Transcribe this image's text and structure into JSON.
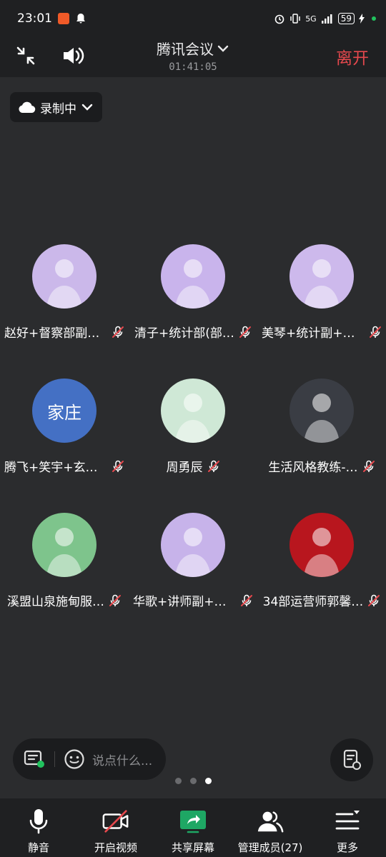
{
  "status": {
    "time": "23:01",
    "network": "5G",
    "battery": "59"
  },
  "header": {
    "title": "腾讯会议",
    "timer": "01:41:05",
    "leave_label": "离开"
  },
  "recording": {
    "label": "录制中"
  },
  "participants": [
    {
      "name": "赵好+督察部副+…",
      "avatar_text": "",
      "avatar_color": "#cbb8ea",
      "muted": true
    },
    {
      "name": "清子+统计部(部…",
      "avatar_text": "",
      "avatar_color": "#c9b4ec",
      "muted": true
    },
    {
      "name": "美琴+统计副+玄…",
      "avatar_text": "",
      "avatar_color": "#cdb9ec",
      "muted": true
    },
    {
      "name": "腾飞+笑宇+玄心…",
      "avatar_text": "家庄",
      "avatar_color": "#4470c4",
      "muted": true
    },
    {
      "name": "周勇辰",
      "avatar_text": "",
      "avatar_color": "#cfe8d6",
      "muted": true
    },
    {
      "name": "生活风格教练-…",
      "avatar_text": "",
      "avatar_color": "#3a3d44",
      "muted": true
    },
    {
      "name": "溪盟山泉施甸服…",
      "avatar_text": "",
      "avatar_color": "#7ec48c",
      "muted": true
    },
    {
      "name": "华歌+讲师副+金…",
      "avatar_text": "",
      "avatar_color": "#c7b3ea",
      "muted": true
    },
    {
      "name": "34部运营师郭馨…",
      "avatar_text": "",
      "avatar_color": "#b8161e",
      "muted": true
    }
  ],
  "chat": {
    "placeholder": "说点什么..."
  },
  "pagination": {
    "total": 3,
    "current": 3
  },
  "toolbar": {
    "mute_label": "静音",
    "video_label": "开启视频",
    "share_label": "共享屏幕",
    "members_label": "管理成员(27)",
    "more_label": "更多"
  },
  "colors": {
    "leave": "#e5484d",
    "share": "#1ea764",
    "background": "#2b2c2e"
  }
}
